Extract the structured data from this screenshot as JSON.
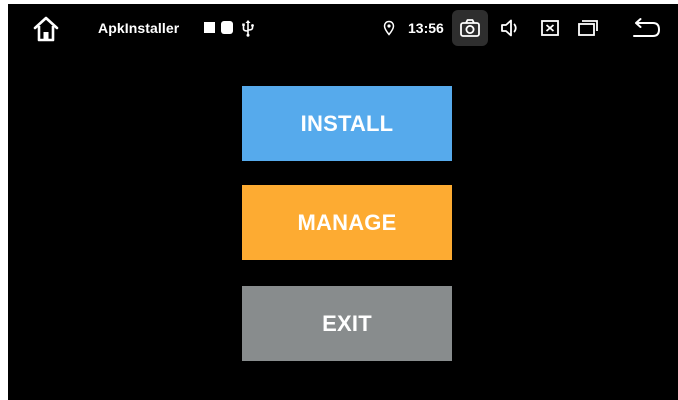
{
  "status_bar": {
    "home_icon": "home-icon",
    "app_name": "ApkInstaller",
    "notification_icons": [
      "square-notification-icon",
      "rounded-notification-icon",
      "usb-icon"
    ],
    "location_icon": "location-icon",
    "time": "13:56",
    "system_buttons": [
      "camera-icon",
      "volume-icon",
      "close-box-icon",
      "recents-icon",
      "back-arrow-icon"
    ]
  },
  "main": {
    "buttons": [
      {
        "label": "INSTALL",
        "color": "#56aaec"
      },
      {
        "label": "MANAGE",
        "color": "#fdab32"
      },
      {
        "label": "EXIT",
        "color": "#888c8d"
      }
    ]
  },
  "colors": {
    "background": "#000000",
    "text": "#ffffff",
    "status_highlight": "#2e2e2e"
  }
}
